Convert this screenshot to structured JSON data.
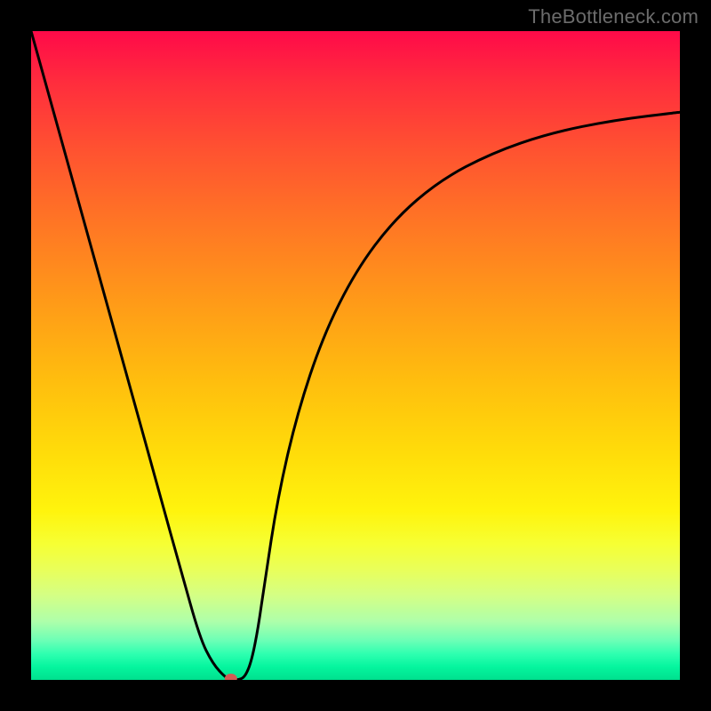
{
  "watermark": "TheBottleneck.com",
  "chart_data": {
    "type": "line",
    "title": "",
    "xlabel": "",
    "ylabel": "",
    "xlim": [
      0,
      1
    ],
    "ylim": [
      0,
      1
    ],
    "grid": false,
    "legend": false,
    "series": [
      {
        "name": "curve",
        "x": [
          0.0,
          0.05,
          0.1,
          0.15,
          0.2,
          0.23,
          0.26,
          0.28,
          0.3,
          0.31,
          0.32,
          0.33,
          0.34,
          0.35,
          0.36,
          0.38,
          0.41,
          0.45,
          0.5,
          0.56,
          0.63,
          0.71,
          0.8,
          0.9,
          1.0
        ],
        "y": [
          1.0,
          0.82,
          0.64,
          0.46,
          0.28,
          0.172,
          0.065,
          0.025,
          0.003,
          0.0,
          0.0,
          0.005,
          0.03,
          0.08,
          0.15,
          0.28,
          0.41,
          0.53,
          0.63,
          0.71,
          0.77,
          0.812,
          0.843,
          0.863,
          0.875
        ]
      }
    ],
    "marker": {
      "x_frac": 0.308,
      "y_frac": 0.002,
      "color": "#d35a54"
    },
    "colors": {
      "curve": "#000000",
      "background_top": "#ff0a49",
      "background_bottom": "#00e08e",
      "frame": "#000000"
    }
  }
}
